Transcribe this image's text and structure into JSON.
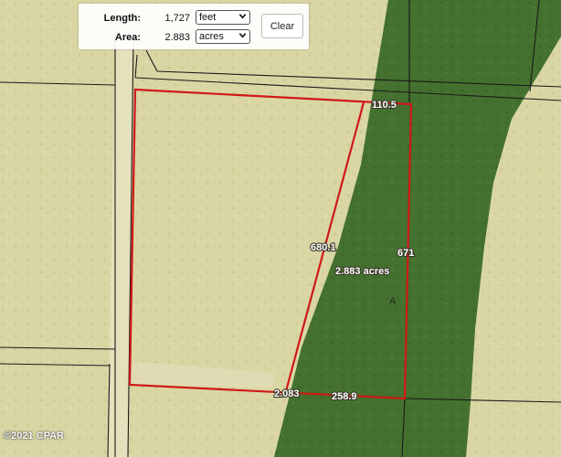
{
  "measure_panel": {
    "length_label": "Length:",
    "length_value": "1,727",
    "length_unit": "feet",
    "area_label": "Area:",
    "area_value": "2.883",
    "area_unit": "acres",
    "clear_label": "Clear"
  },
  "map": {
    "segment_labels": {
      "top": "110.5",
      "left_diagonal": "680.1",
      "right": "671",
      "bottom_left": "2.083",
      "bottom_right": "258.9"
    },
    "area_label": "2.883 acres",
    "zone_label": "A",
    "copyright": "©2021 CPAR"
  },
  "colors": {
    "land": "#d9d6a4",
    "flood_zone": "#3f6b2e",
    "parcel_outline": "#d01818",
    "parcel_lines": "#1a1a1a",
    "road": "#eae6c4"
  },
  "icons": {
    "dropdown": "chevron-down-icon"
  }
}
